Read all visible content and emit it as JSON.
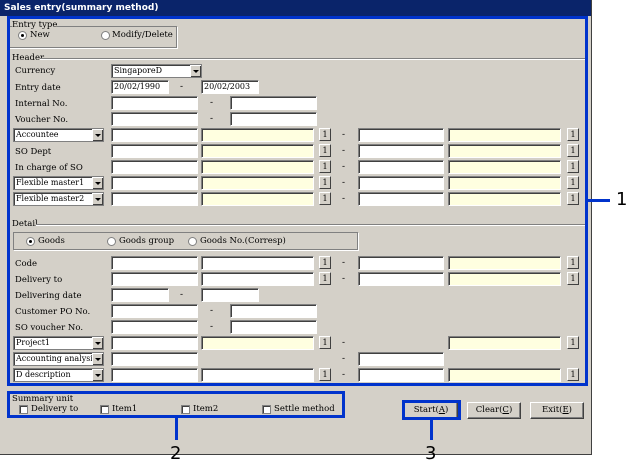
{
  "window": {
    "title": "Sales entry(summary method)"
  },
  "entry_type": {
    "legend": "Entry type",
    "options": [
      {
        "label": "New",
        "selected": true
      },
      {
        "label": "Modify/Delete",
        "selected": false
      }
    ]
  },
  "header": {
    "legend": "Header",
    "currency_label": "Currency",
    "currency_value": "SingaporeD",
    "entry_date_label": "Entry date",
    "entry_date_from": "20/02/1990",
    "entry_date_to": "20/02/2003",
    "internal_no_label": "Internal No.",
    "voucher_no_label": "Voucher No.",
    "accountee_label": "Accountee",
    "so_dept_label": "SO Dept",
    "in_charge_label": "In charge of SO",
    "flex1_label": "Flexible master1",
    "flex2_label": "Flexible master2"
  },
  "detail": {
    "legend": "Detail",
    "options": [
      {
        "label": "Goods",
        "selected": true
      },
      {
        "label": "Goods group",
        "selected": false
      },
      {
        "label": "Goods No.(Corresp)",
        "selected": false
      }
    ],
    "code_label": "Code",
    "delivery_to_label": "Delivery to",
    "delivering_date_label": "Delivering date",
    "customer_po_label": "Customer PO No.",
    "so_voucher_label": "SO voucher No.",
    "project_label": "Project1",
    "accounting_label": "Accounting analysis cc",
    "d_desc_label": "D description"
  },
  "summary_unit": {
    "legend": "Summary unit",
    "items": [
      "Delivery to",
      "Item1",
      "Item2",
      "Settle method"
    ]
  },
  "buttons": {
    "start_prefix": "Start(",
    "start_key": "A",
    "start_suffix": ")",
    "clear_prefix": "Clear(",
    "clear_key": "C",
    "clear_suffix": ")",
    "exit_prefix": "Exit(",
    "exit_key": "E",
    "exit_suffix": ")"
  },
  "lookup_glyph": "1",
  "range_dash": "-",
  "callouts": {
    "one": "1",
    "two": "2",
    "three": "3"
  },
  "colors": {
    "title_bar": "#0a246a",
    "window": "#d4d0c8",
    "callout": "#0033cc",
    "highlight_field": "#ffffe0"
  }
}
